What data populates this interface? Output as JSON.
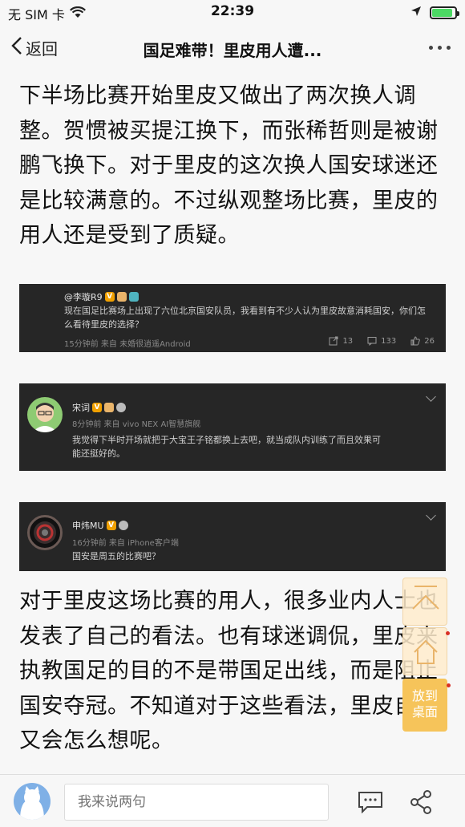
{
  "status_bar": {
    "carrier": "无 SIM 卡",
    "time": "22:39",
    "battery_level": 0.9
  },
  "nav": {
    "back_label": "返回",
    "title": "国足难带！里皮用人遭..."
  },
  "article": {
    "para1_lines": [
      "下半场比赛开始里皮又做出了两次换人调",
      "整。贺惯被买提江换下，而张稀哲则是被谢",
      "鹏飞换下。对于里皮的这次换人国安球迷还",
      "是比较满意的。不过纵观整场比赛，里皮的",
      "用人还是受到了质疑。"
    ],
    "para2_lines": [
      "对于里皮这场比赛的用人，很多业内人士也",
      "发表了自己的看法。也有球迷调侃，里皮来",
      "执教国足的目的不是带国足出线，而是阻止",
      "国安夺冠。不知道对于这些看法，里皮自己",
      "又会怎么想呢。"
    ]
  },
  "comments": [
    {
      "user": "@李璇R9",
      "text_lines": [
        "现在国足比赛场上出现了六位北京国安队员，我看到有不少人认为里皮故意消耗国安，你们怎",
        "么看待里皮的选择？"
      ],
      "meta": "15分钟前  来自 未婚很逍遥Android",
      "reposts": "13",
      "comments_count": "133",
      "likes": "26"
    },
    {
      "user": "宋词",
      "meta": "8分钟前  来自 vivo NEX AI智慧旗舰",
      "text_lines": [
        "我觉得下半时开场就把于大宝王子铭都换上去吧，就当成队内训练了而且效果可",
        "能还挺好的。"
      ]
    },
    {
      "user": "申炜MU",
      "meta": "16分钟前  来自 iPhone客户端",
      "text_lines": [
        "国安是周五的比赛吧？"
      ]
    }
  ],
  "floating": {
    "desktop_line1": "放到",
    "desktop_line2": "桌面"
  },
  "bottom": {
    "input_placeholder": "我来说两句"
  },
  "colors": {
    "card_bg": "#262626",
    "float_accent": "#f6c45a",
    "verified": "#f0a000"
  }
}
